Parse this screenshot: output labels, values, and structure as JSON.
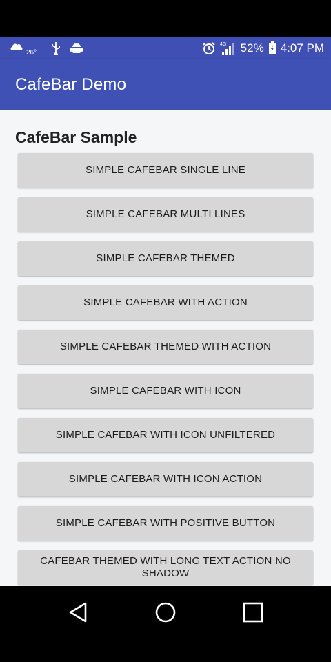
{
  "status_bar": {
    "temperature": "26°",
    "battery_percent": "52%",
    "time": "4:07 PM",
    "network": "4G",
    "icons": [
      "weather-icon",
      "usb-icon",
      "android-debug-icon",
      "alarm-icon",
      "signal-icon",
      "battery-icon"
    ]
  },
  "app_bar": {
    "title": "CafeBar Demo"
  },
  "main": {
    "section_title": "CafeBar Sample",
    "buttons": [
      "SIMPLE CAFEBAR SINGLE LINE",
      "SIMPLE CAFEBAR MULTI LINES",
      "SIMPLE CAFEBAR THEMED",
      "SIMPLE CAFEBAR WITH ACTION",
      "SIMPLE CAFEBAR THEMED WITH ACTION",
      "SIMPLE CAFEBAR WITH ICON",
      "SIMPLE CAFEBAR WITH ICON UNFILTERED",
      "SIMPLE CAFEBAR WITH ICON ACTION",
      "SIMPLE CAFEBAR WITH POSITIVE BUTTON",
      "CAFEBAR THEMED WITH LONG TEXT ACTION NO SHADOW"
    ]
  },
  "nav_bar": {
    "icons": [
      "back-icon",
      "home-icon",
      "recents-icon"
    ]
  },
  "colors": {
    "primary": "#3f51b5",
    "status_bar": "#3f4fb4",
    "button_bg": "#d7d7d7",
    "content_bg": "#f4f6f8"
  }
}
